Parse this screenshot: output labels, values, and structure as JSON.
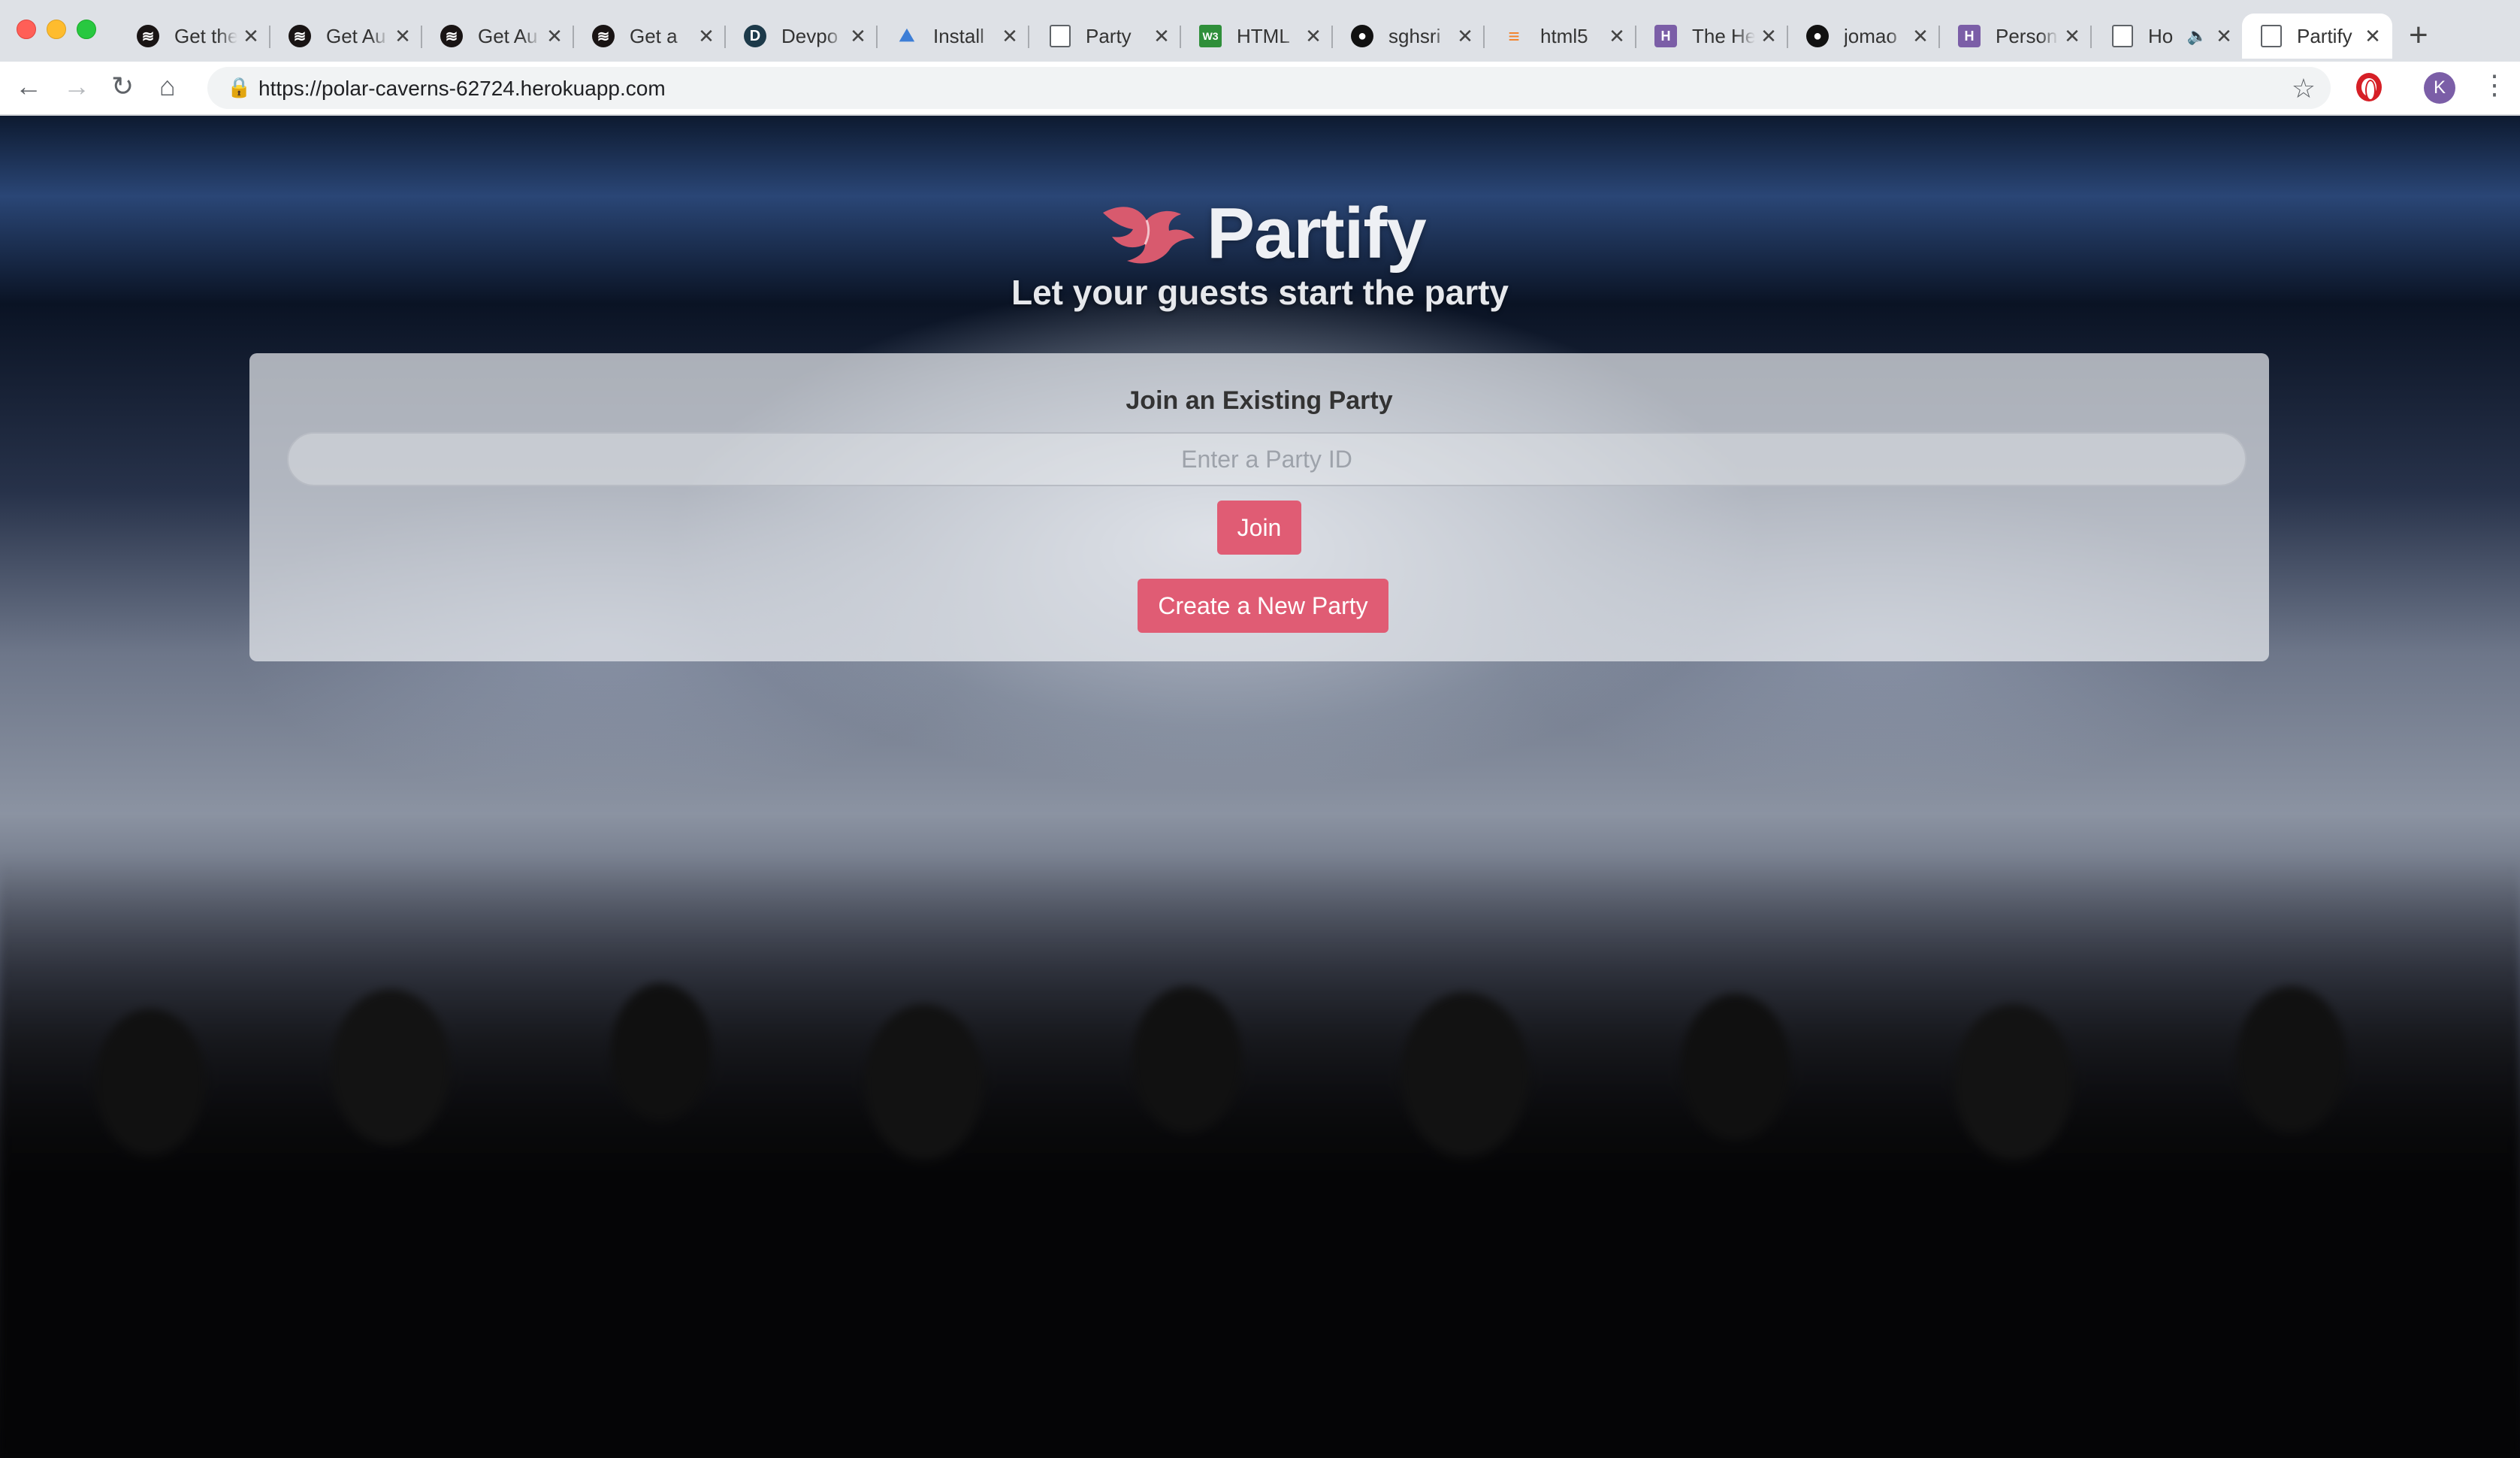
{
  "browser": {
    "tabs": [
      {
        "icon": "spotify-icon",
        "title": "Get the"
      },
      {
        "icon": "spotify-icon",
        "title": "Get Au"
      },
      {
        "icon": "spotify-icon",
        "title": "Get Au"
      },
      {
        "icon": "spotify-icon",
        "title": "Get a"
      },
      {
        "icon": "devpost-icon",
        "title": "Devpo"
      },
      {
        "icon": "install-icon",
        "title": "Install"
      },
      {
        "icon": "page-icon",
        "title": "Party"
      },
      {
        "icon": "html-icon",
        "title": "HTML"
      },
      {
        "icon": "github-icon",
        "title": "sghsri"
      },
      {
        "icon": "stackoverflow-icon",
        "title": "html5"
      },
      {
        "icon": "heroku-icon",
        "title": "The He"
      },
      {
        "icon": "github-icon",
        "title": "jomao"
      },
      {
        "icon": "heroku-icon",
        "title": "Person"
      },
      {
        "icon": "page-icon",
        "title": "Ho"
      },
      {
        "icon": "page-icon",
        "title": "Partify"
      }
    ],
    "active_tab": "Partify",
    "url": "https://polar-caverns-62724.herokuapp.com",
    "profile_initial": "K",
    "colors": {
      "tabstrip": "#dee1e6",
      "profile": "#7b5ea7"
    }
  },
  "page": {
    "brand": "Partify",
    "tagline": "Let your guests start the party",
    "join_heading": "Join an Existing Party",
    "party_id_placeholder": "Enter a Party ID",
    "party_id_value": "",
    "join_label": "Join",
    "create_label": "Create a New Party",
    "colors": {
      "accent": "#e05c74",
      "brand_text": "#eef0f4"
    }
  }
}
